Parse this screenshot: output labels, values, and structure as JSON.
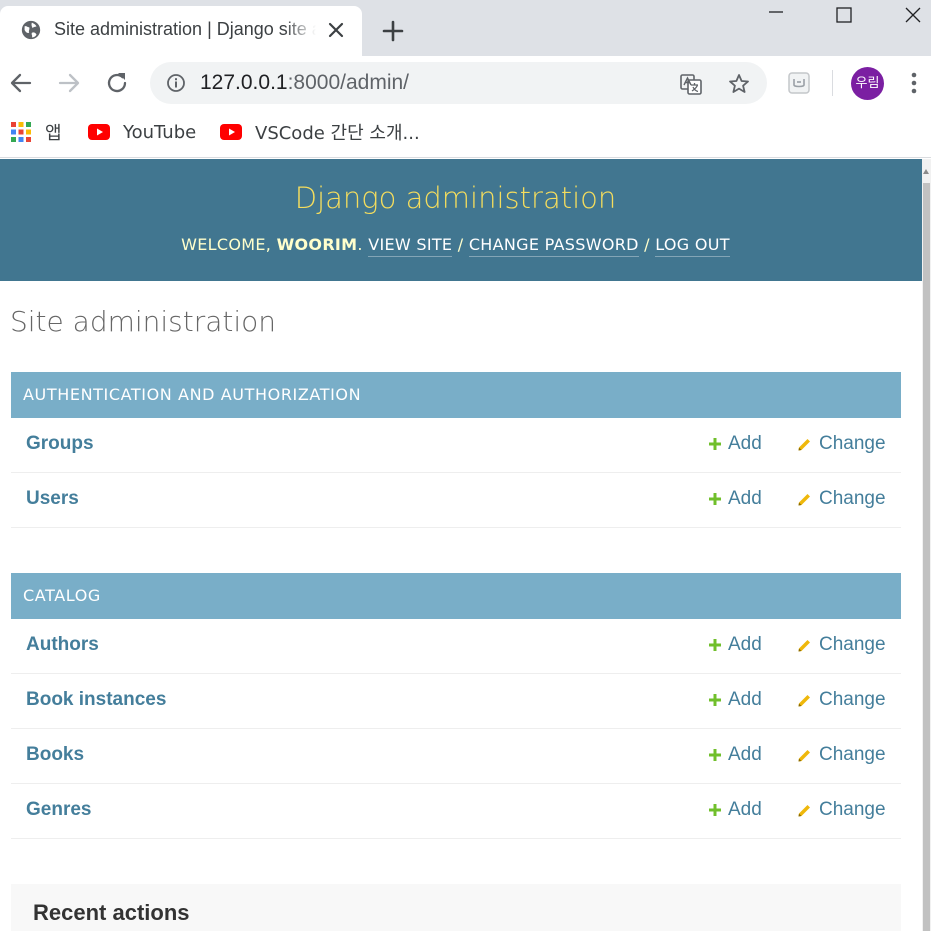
{
  "browser": {
    "tab": {
      "title": "Site administration | Django site admin"
    },
    "address": {
      "host": "127.0.0.1",
      "path": ":8000/admin/"
    },
    "profile": {
      "initials": "우림",
      "color": "#7b1fa2"
    },
    "bookmarks": [
      {
        "label": "앱",
        "icon": "apps-grid-icon"
      },
      {
        "label": "YouTube",
        "icon": "youtube-icon"
      },
      {
        "label": "VSCode 간단 소개...",
        "icon": "youtube-icon"
      }
    ]
  },
  "admin": {
    "branding": "Django administration",
    "user_tools": {
      "welcome": "WELCOME, ",
      "username": "WOORIM",
      "period": ". ",
      "view_site": "VIEW SITE",
      "separator": " / ",
      "change_password": "CHANGE PASSWORD",
      "log_out": "LOG OUT"
    },
    "page_title": "Site administration",
    "action_labels": {
      "add": "Add",
      "change": "Change"
    },
    "apps": [
      {
        "caption": "AUTHENTICATION AND AUTHORIZATION",
        "models": [
          "Groups",
          "Users"
        ]
      },
      {
        "caption": "CATALOG",
        "models": [
          "Authors",
          "Book instances",
          "Books",
          "Genres"
        ]
      }
    ],
    "recent_actions": {
      "title": "Recent actions"
    },
    "colors": {
      "header_bg": "#417690",
      "branding": "#f5dd5d",
      "caption_bg": "#79aec8",
      "link": "#447e9b",
      "add_icon": "#70bf2b",
      "change_icon": "#efb80b"
    }
  }
}
